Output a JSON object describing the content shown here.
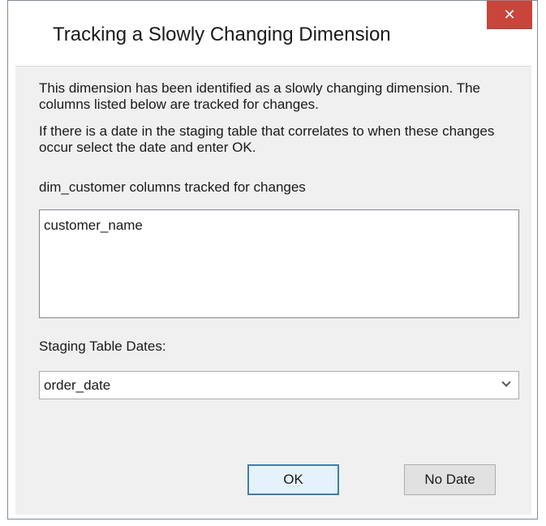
{
  "dialog": {
    "title": "Tracking a Slowly Changing Dimension",
    "close_symbol": "✕",
    "intro_text": "This dimension has been identified as a slowly changing dimension. The columns listed below are tracked for changes.",
    "date_text": "If there is a date in the staging table that correlates to when these changes occur select the date and enter OK.",
    "tracked_label": "dim_customer columns tracked for changes",
    "tracked_columns": [
      "customer_name"
    ],
    "staging_label": "Staging Table Dates:",
    "staging_selected": "order_date",
    "ok_label": "OK",
    "no_date_label": "No Date"
  },
  "colors": {
    "close_button": "#c7453a",
    "client_background": "#f0f0f0",
    "default_button_border": "#3c7fb1"
  },
  "icons": {
    "close": "close-icon",
    "dropdown": "chevron-down-icon"
  }
}
